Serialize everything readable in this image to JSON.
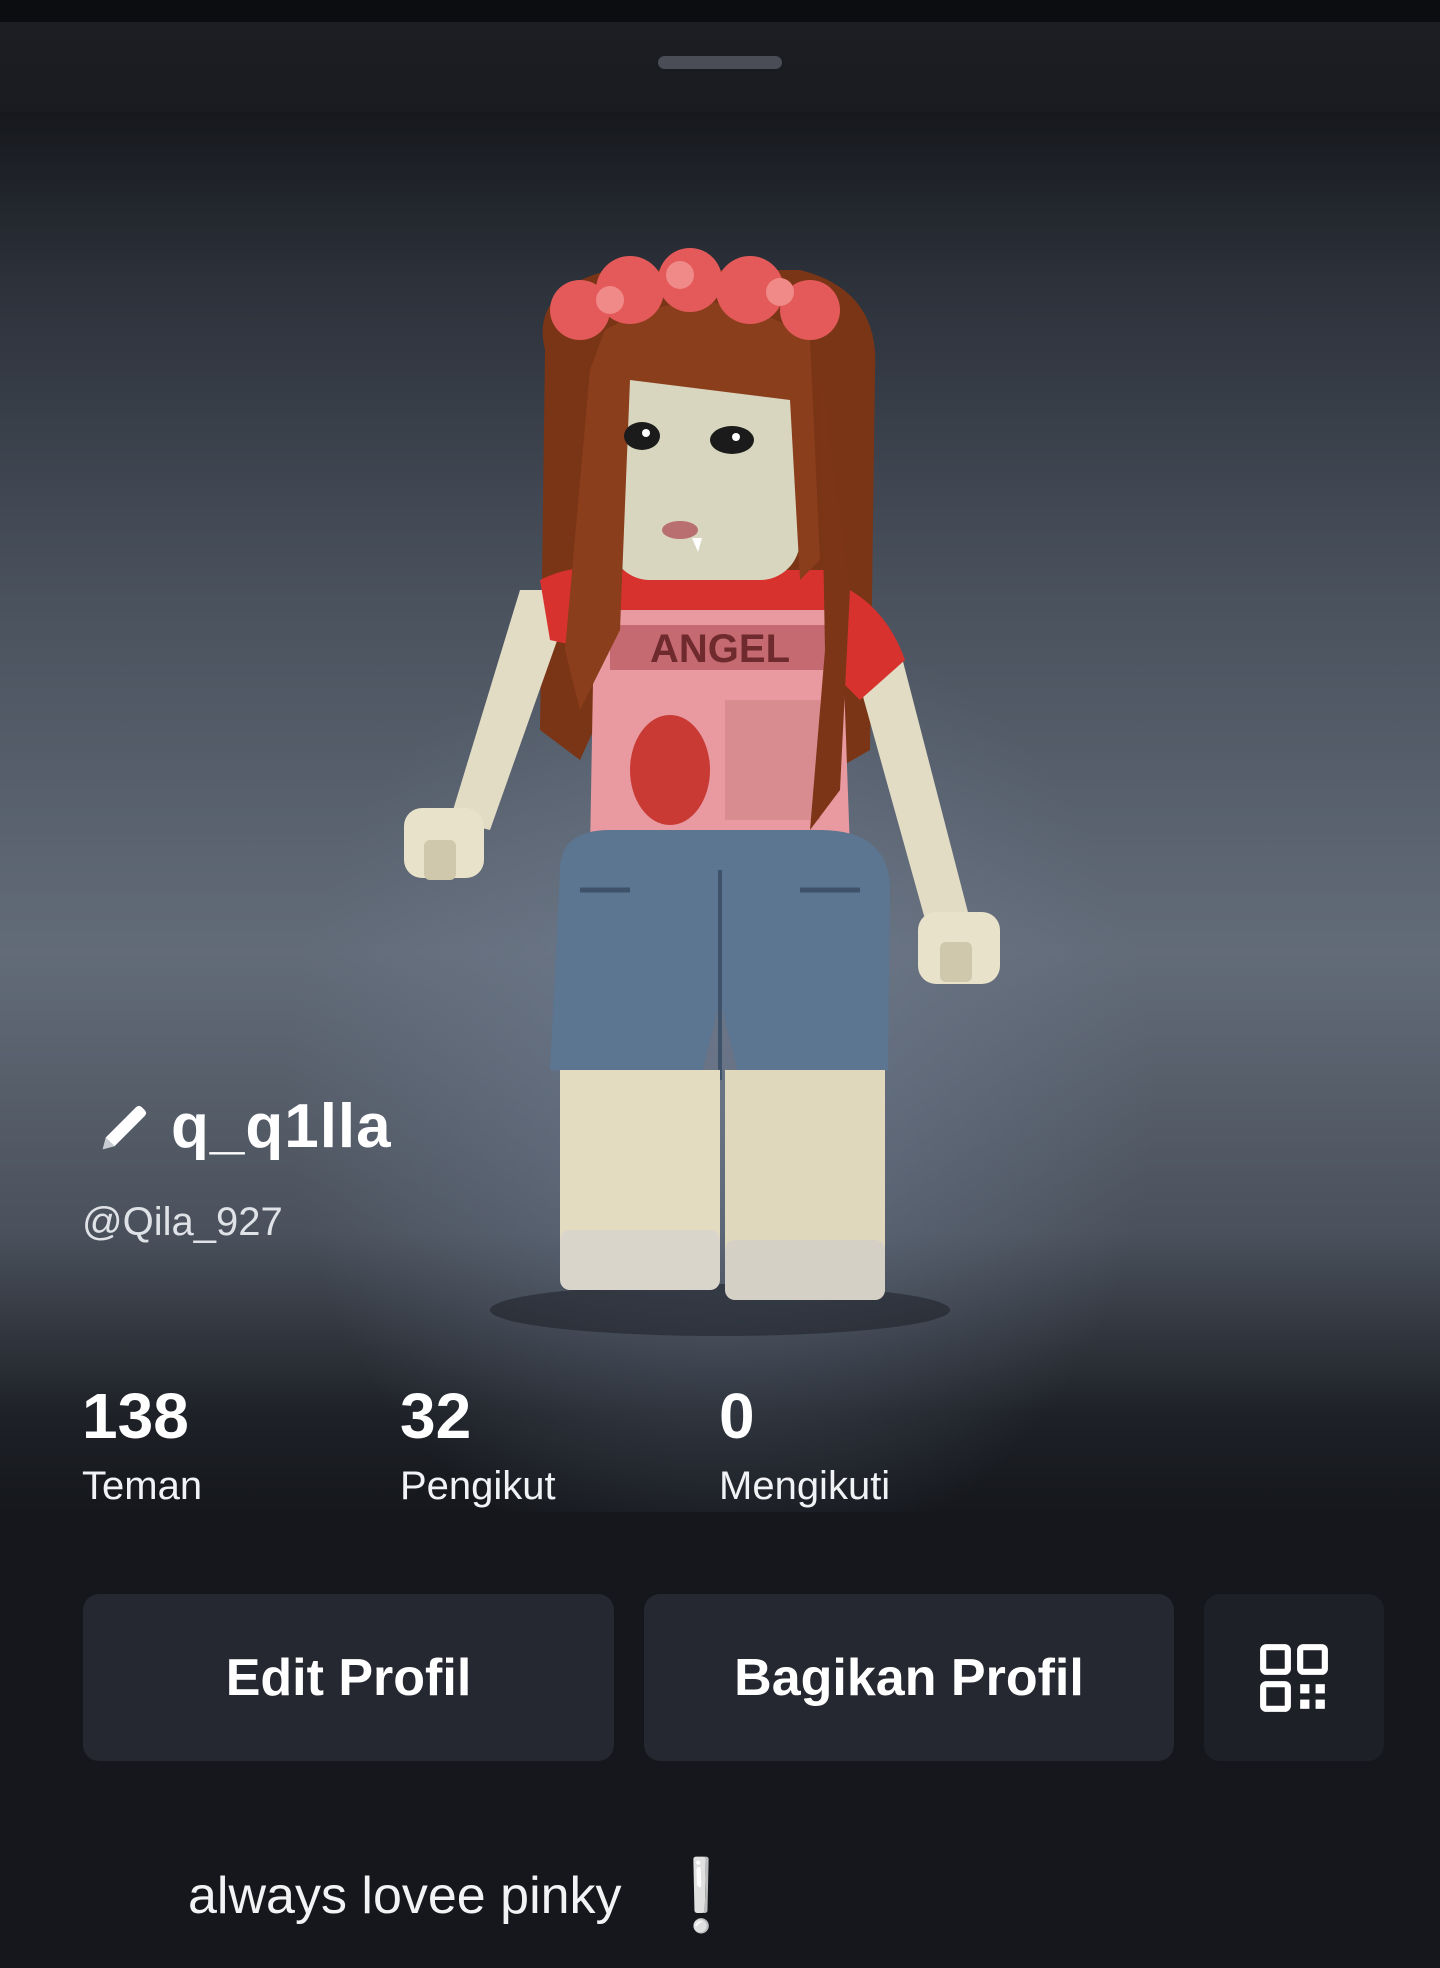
{
  "sheet": {
    "handle": "drag-handle"
  },
  "profile": {
    "display_name": "q_q1lla",
    "username": "@Qila_927",
    "edit_icon": "pencil-icon",
    "bio": "always lovee pinky",
    "bio_emoji": "❕"
  },
  "stats": [
    {
      "value": "138",
      "label": "Teman"
    },
    {
      "value": "32",
      "label": "Pengikut"
    },
    {
      "value": "0",
      "label": "Mengikuti"
    }
  ],
  "actions": {
    "edit_label": "Edit Profil",
    "share_label": "Bagikan Profil",
    "qr_icon": "qr-code-icon"
  },
  "avatar": {
    "shirt_text": "ANGEL"
  }
}
